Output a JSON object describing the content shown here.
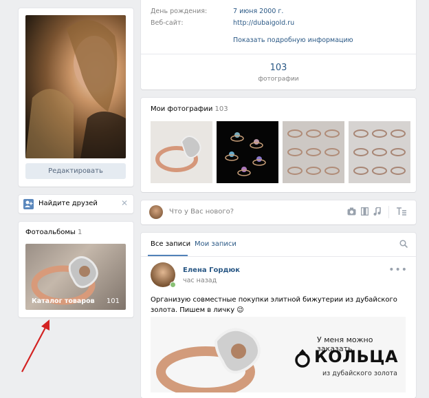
{
  "profile": {
    "edit_button": "Редактировать"
  },
  "info": {
    "birthday_label": "День рождения:",
    "birthday_value": "7 июня 2000 г.",
    "website_label": "Веб-сайт:",
    "website_value": "http://dubaigold.ru",
    "show_more": "Показать подробную информацию",
    "photos_count": "103",
    "photos_label": "фотографии"
  },
  "find_friends": {
    "label": "Найдите друзей",
    "close": "✕"
  },
  "albums": {
    "title": "Фотоальбомы",
    "count": "1",
    "album_name": "Каталог товаров",
    "album_count": "101"
  },
  "my_photos": {
    "title": "Мои фотографии",
    "count": "103"
  },
  "post_box": {
    "placeholder": "Что у Вас нового?"
  },
  "wall": {
    "tab_all": "Все записи",
    "tab_mine": "Мои записи",
    "post": {
      "author": "Елена Гордюк",
      "time": "час назад",
      "text": "Организую совместные покупки элитной бижутерии из дубайского золота. Пишем в личку 😉",
      "banner_line1": "У меня можно заказать",
      "banner_big": "КОЛЬЦА",
      "banner_line3": "из дубайского золота"
    }
  },
  "colors": {
    "link": "#2a5885",
    "accent": "#5181b8",
    "arrow": "#d32222"
  }
}
